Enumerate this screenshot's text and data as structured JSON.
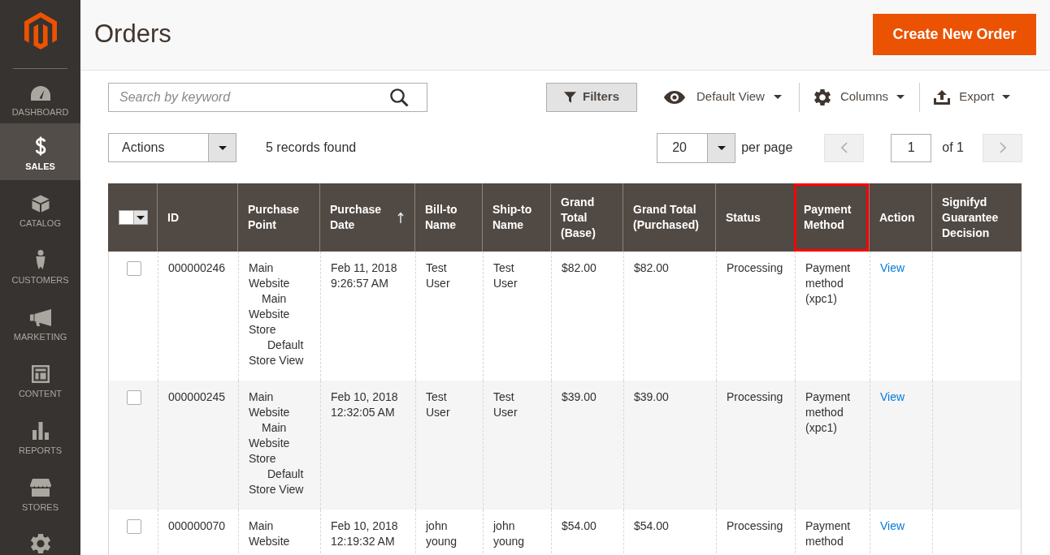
{
  "sidebar": {
    "items": [
      {
        "label": "DASHBOARD",
        "selected": false
      },
      {
        "label": "SALES",
        "selected": true
      },
      {
        "label": "CATALOG",
        "selected": false
      },
      {
        "label": "CUSTOMERS",
        "selected": false
      },
      {
        "label": "MARKETING",
        "selected": false
      },
      {
        "label": "CONTENT",
        "selected": false
      },
      {
        "label": "REPORTS",
        "selected": false
      },
      {
        "label": "STORES",
        "selected": false
      },
      {
        "selected": false
      }
    ]
  },
  "page_header": {
    "title": "Orders",
    "create_button": "Create New Order"
  },
  "toolbar": {
    "search": {
      "placeholder": "Search by keyword"
    },
    "filters_button": "Filters",
    "view_menu": "Default View",
    "columns_menu": "Columns",
    "export_menu": "Export"
  },
  "grid_controls": {
    "actions_select": "Actions",
    "records_found": "5 records found",
    "per_page": {
      "value": "20",
      "label": "per page"
    },
    "pagination": {
      "prev": {
        "disabled": true
      },
      "page": "1",
      "total": "of 1",
      "next": {
        "disabled": true
      }
    }
  },
  "table": {
    "columns": [
      {
        "kind": "mass-select",
        "checked": false,
        "sorted": false,
        "highlighted": false
      },
      {
        "kind": "text",
        "label": "ID",
        "sorted": false,
        "highlighted": false
      },
      {
        "kind": "text",
        "label": "Purchase Point",
        "sorted": false,
        "highlighted": false
      },
      {
        "kind": "text",
        "label": "Purchase Date",
        "sorted": true,
        "highlighted": false
      },
      {
        "kind": "text",
        "label": "Bill-to Name",
        "sorted": false,
        "highlighted": false
      },
      {
        "kind": "text",
        "label": "Ship-to Name",
        "sorted": false,
        "highlighted": false
      },
      {
        "kind": "text",
        "label": "Grand Total (Base)",
        "sorted": false,
        "highlighted": false
      },
      {
        "kind": "text",
        "label": "Grand Total (Purchased)",
        "sorted": false,
        "highlighted": false
      },
      {
        "kind": "text",
        "label": "Status",
        "sorted": false,
        "highlighted": false
      },
      {
        "kind": "text",
        "label": "Payment Method",
        "sorted": false,
        "highlighted": true
      },
      {
        "kind": "text",
        "label": "Action",
        "sorted": false,
        "highlighted": false
      },
      {
        "kind": "text",
        "label": "Signifyd Guarantee Decision",
        "sorted": false,
        "highlighted": false
      }
    ],
    "rows": [
      {
        "checked": false,
        "id": "000000246",
        "purchase_point": {
          "label": "Main Website",
          "children": [
            {
              "label": "Main Website Store",
              "children": [
                {
                  "label": "Default Store View"
                }
              ]
            }
          ]
        },
        "purchase_date": "Feb 11, 2018 9:26:57 AM",
        "bill_to_name": "Test User",
        "ship_to_name": "Test User",
        "grand_total_base": "$82.00",
        "grand_total_purchased": "$82.00",
        "status": "Processing",
        "payment_method": "Payment method (xpc1)",
        "action": "View"
      },
      {
        "checked": false,
        "id": "000000245",
        "purchase_point": {
          "label": "Main Website",
          "children": [
            {
              "label": "Main Website Store",
              "children": [
                {
                  "label": "Default Store View"
                }
              ]
            }
          ]
        },
        "purchase_date": "Feb 10, 2018 12:32:05 AM",
        "bill_to_name": "Test User",
        "ship_to_name": "Test User",
        "grand_total_base": "$39.00",
        "grand_total_purchased": "$39.00",
        "status": "Processing",
        "payment_method": "Payment method (xpc1)",
        "action": "View"
      },
      {
        "checked": false,
        "id": "000000070",
        "purchase_point": {
          "label": "Main Website"
        },
        "purchase_date": "Feb 10, 2018 12:19:32 AM",
        "bill_to_name": "john young",
        "ship_to_name": "john young",
        "grand_total_base": "$54.00",
        "grand_total_purchased": "$54.00",
        "status": "Processing",
        "payment_method": "Payment method",
        "action": "View"
      }
    ]
  }
}
